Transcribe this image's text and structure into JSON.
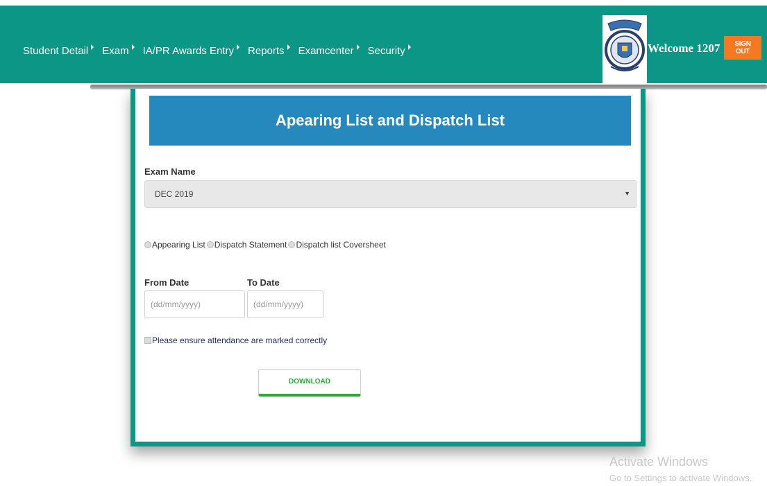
{
  "nav": {
    "items": [
      {
        "label": "Student Detail"
      },
      {
        "label": "Exam"
      },
      {
        "label": "IA/PR Awards Entry"
      },
      {
        "label": "Reports"
      },
      {
        "label": "Examcenter"
      },
      {
        "label": "Security"
      }
    ]
  },
  "header": {
    "welcome": "Welcome 1207",
    "signout_label": "SIGN OUT"
  },
  "form": {
    "title": "Apearing List and Dispatch List",
    "exam_name_label": "Exam Name",
    "exam_name_value": "DEC 2019",
    "radio_options": [
      "Appearing List",
      "Dispatch Statement",
      "Dispatch list Coversheet"
    ],
    "from_date_label": "From Date",
    "to_date_label": "To Date",
    "date_placeholder": "(dd/mm/yyyy)",
    "attendance_check_label": "Please ensure attendance are marked correctly",
    "download_label": "DOWNLOAD"
  },
  "watermark": {
    "title": "Activate Windows",
    "subtitle": "Go to Settings to activate Windows."
  },
  "colors": {
    "topbar": "#0b9685",
    "card_header": "#2589bd",
    "signout": "#f57a1f",
    "download_accent": "#2fa83a"
  }
}
